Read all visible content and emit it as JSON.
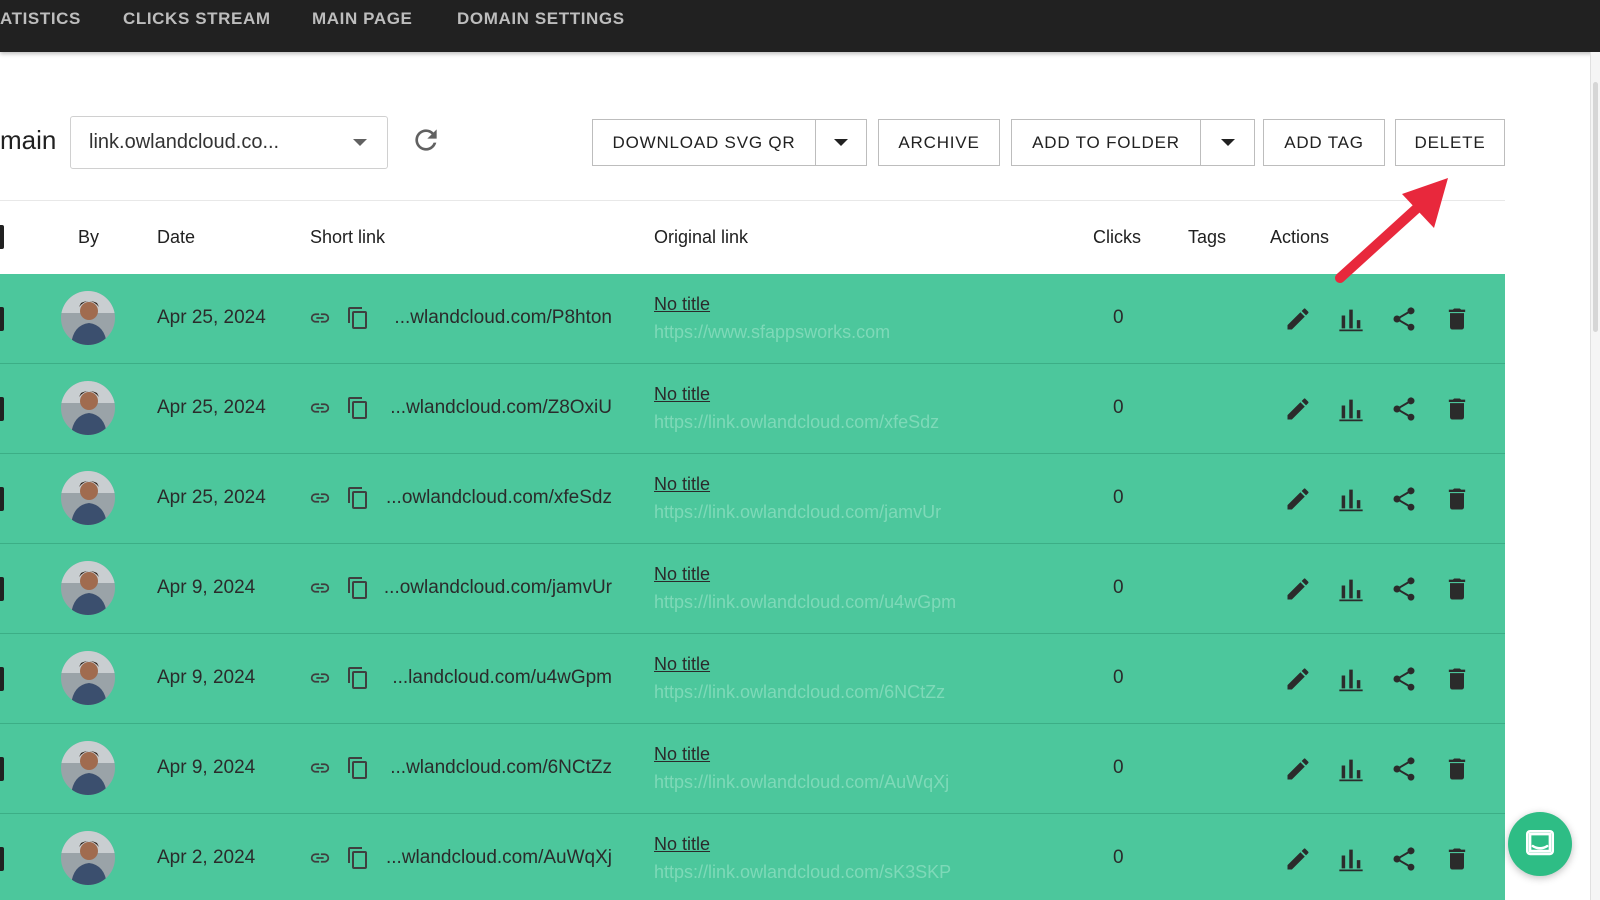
{
  "nav": {
    "tabs": [
      "ATISTICS",
      "CLICKS STREAM",
      "MAIN PAGE",
      "DOMAIN SETTINGS"
    ]
  },
  "toolbar": {
    "domain_label": "main",
    "domain_value": "link.owlandcloud.co...",
    "download_label": "DOWNLOAD SVG QR",
    "archive_label": "ARCHIVE",
    "add_folder_label": "ADD TO FOLDER",
    "add_tag_label": "ADD TAG",
    "delete_label": "DELETE"
  },
  "table": {
    "headers": {
      "by": "By",
      "date": "Date",
      "short": "Short link",
      "original": "Original link",
      "clicks": "Clicks",
      "tags": "Tags",
      "actions": "Actions"
    },
    "rows": [
      {
        "date": "Apr 25, 2024",
        "short": "...wlandcloud.com/P8hton",
        "title": "No title",
        "url": "https://www.sfappsworks.com",
        "clicks": "0"
      },
      {
        "date": "Apr 25, 2024",
        "short": "...wlandcloud.com/Z8OxiU",
        "title": "No title",
        "url": "https://link.owlandcloud.com/xfeSdz",
        "clicks": "0"
      },
      {
        "date": "Apr 25, 2024",
        "short": "...owlandcloud.com/xfeSdz",
        "title": "No title",
        "url": "https://link.owlandcloud.com/jamvUr",
        "clicks": "0"
      },
      {
        "date": "Apr 9, 2024",
        "short": "...owlandcloud.com/jamvUr",
        "title": "No title",
        "url": "https://link.owlandcloud.com/u4wGpm",
        "clicks": "0"
      },
      {
        "date": "Apr 9, 2024",
        "short": "...landcloud.com/u4wGpm",
        "title": "No title",
        "url": "https://link.owlandcloud.com/6NCtZz",
        "clicks": "0"
      },
      {
        "date": "Apr 9, 2024",
        "short": "...wlandcloud.com/6NCtZz",
        "title": "No title",
        "url": "https://link.owlandcloud.com/AuWqXj",
        "clicks": "0"
      },
      {
        "date": "Apr 2, 2024",
        "short": "...wlandcloud.com/AuWqXj",
        "title": "No title",
        "url": "https://link.owlandcloud.com/sK3SKP",
        "clicks": "0"
      }
    ]
  },
  "colors": {
    "nav_bg": "#212121",
    "row_bg": "#4cc79c",
    "url_text": "#7ed9b8",
    "annotation_arrow": "#e8283c",
    "chat_bubble": "#2ebd85"
  },
  "icons": [
    "refresh-icon",
    "chevron-down-icon",
    "link-icon",
    "copy-icon",
    "edit-icon",
    "stats-icon",
    "share-icon",
    "delete-icon",
    "chat-icon"
  ]
}
